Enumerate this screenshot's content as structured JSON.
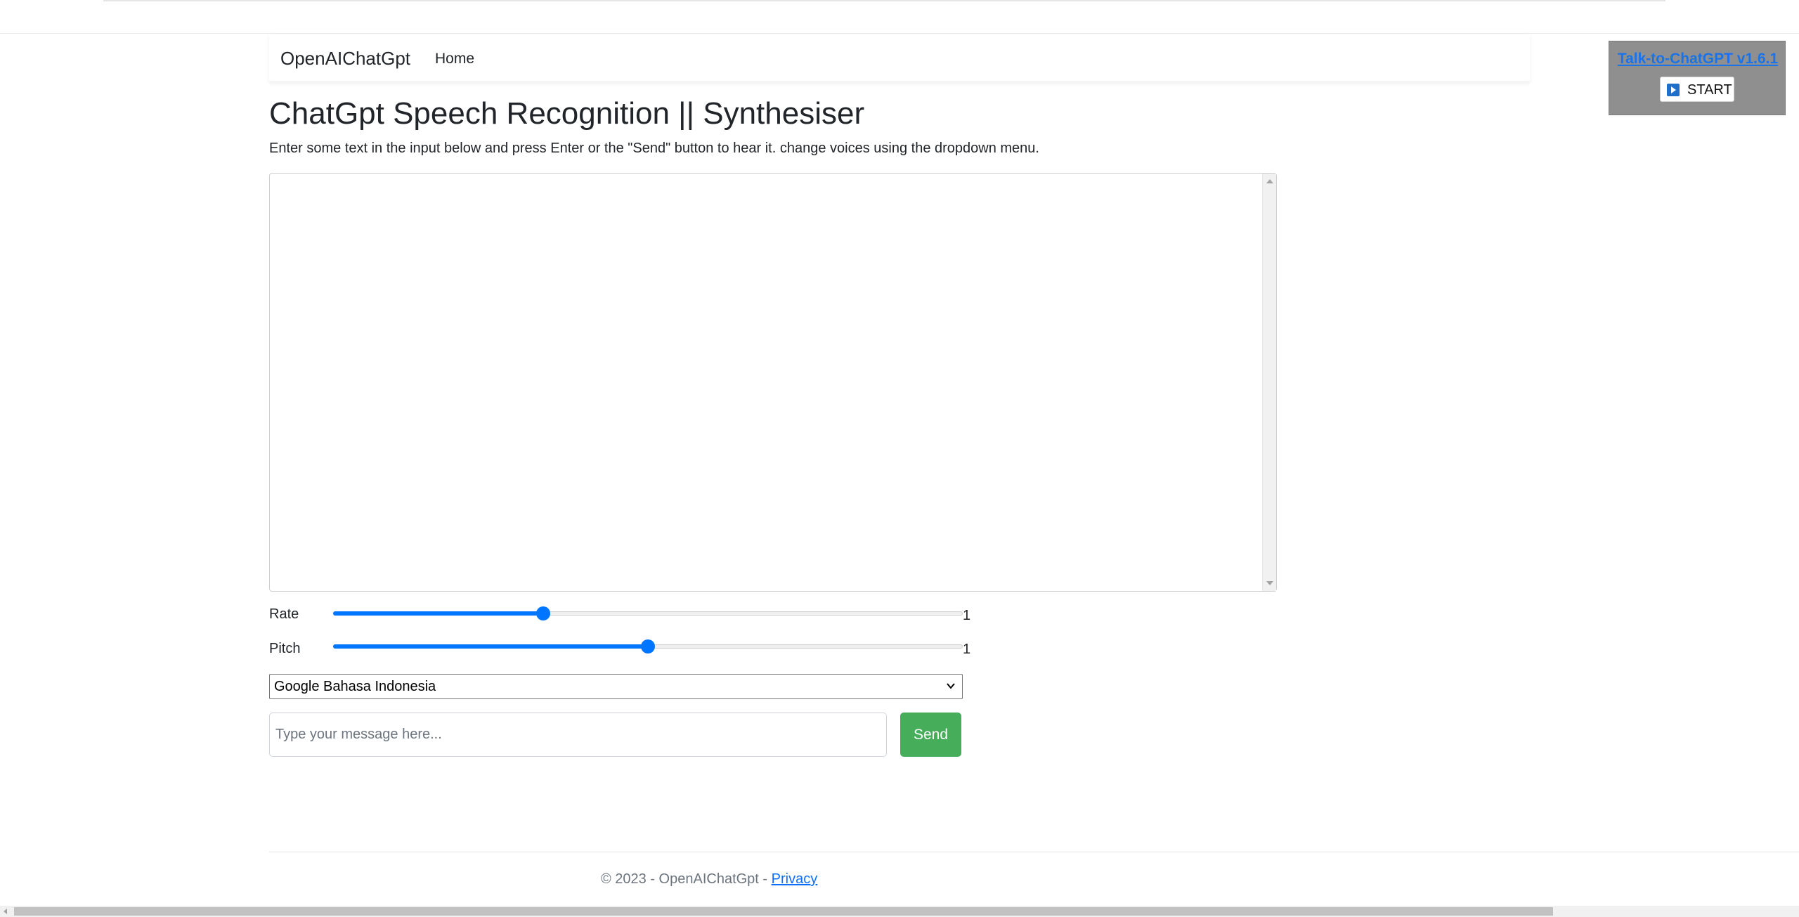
{
  "navbar": {
    "brand": "OpenAIChatGpt",
    "home": "Home"
  },
  "header": {
    "title": "ChatGpt Speech Recognition || Synthesiser",
    "instructions": "Enter some text in the input below and press Enter or the \"Send\" button to hear it. change voices using the dropdown menu."
  },
  "output": {
    "text": ""
  },
  "controls": {
    "rate": {
      "label": "Rate",
      "value_text": "1",
      "min": 0.5,
      "max": 2,
      "value": 1
    },
    "pitch": {
      "label": "Pitch",
      "value_text": "1",
      "min": 0,
      "max": 2,
      "value": 1
    },
    "voice": {
      "selected": "Google Bahasa Indonesia"
    }
  },
  "message": {
    "placeholder": "Type your message here...",
    "value": "",
    "send_label": "Send"
  },
  "footer": {
    "copyright": "© 2023 - OpenAIChatGpt - ",
    "privacy": "Privacy"
  },
  "extension": {
    "link": "Talk-to-ChatGPT v1.6.1",
    "start": "START"
  },
  "colors": {
    "accent": "#0075ff",
    "send": "#46ad5b",
    "link": "#0d6efd",
    "extension_bg": "#8f8f8f"
  }
}
